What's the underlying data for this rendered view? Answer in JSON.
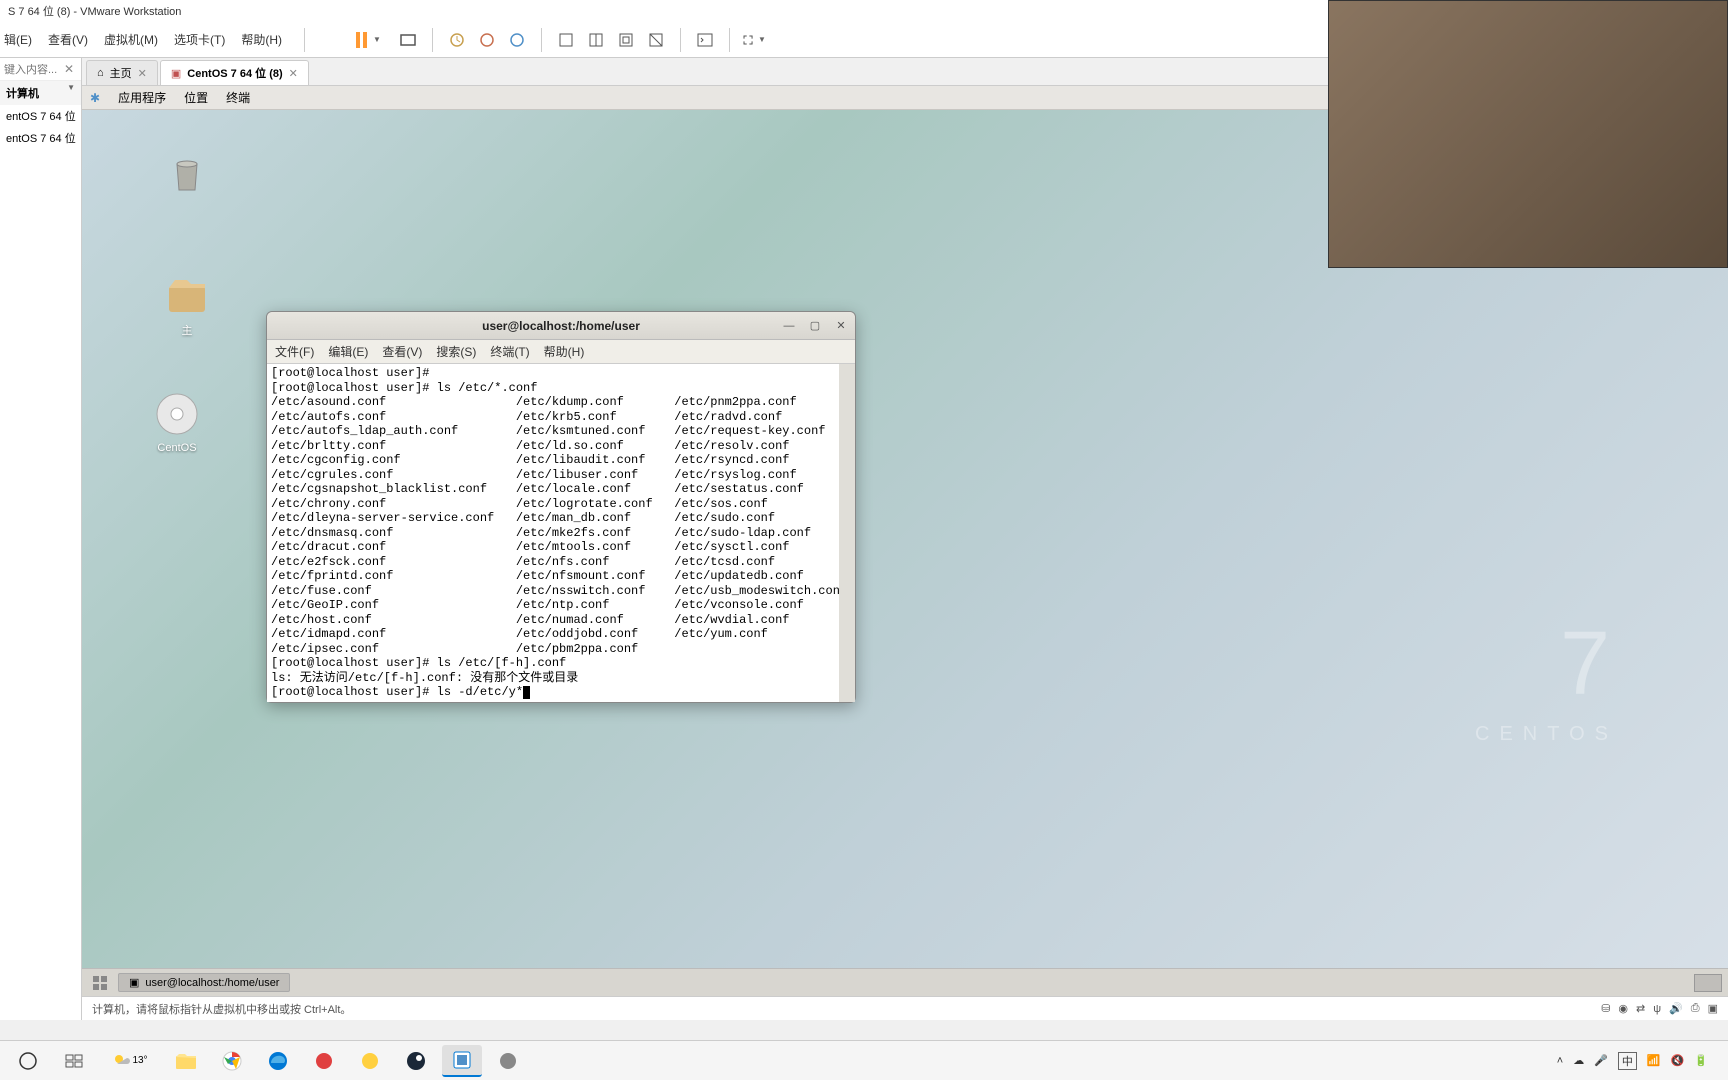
{
  "app": {
    "title": "S 7 64 位 (8) - VMware Workstation"
  },
  "menubar": [
    "辑(E)",
    "查看(V)",
    "虚拟机(M)",
    "选项卡(T)",
    "帮助(H)"
  ],
  "sidebar": {
    "search_placeholder": "键入内容...",
    "lib_header": "计算机",
    "vms": [
      "entOS 7 64 位",
      "entOS 7 64 位"
    ]
  },
  "tabs": [
    {
      "label": "主页",
      "icon": "home",
      "active": false
    },
    {
      "label": "CentOS 7 64 位 (8)",
      "icon": "vm",
      "active": true
    }
  ],
  "guest_menubar": [
    "应用程序",
    "位置",
    "终端"
  ],
  "desktop_icons": [
    {
      "name": "trash",
      "label": ""
    },
    {
      "name": "folder",
      "label": "主"
    },
    {
      "name": "disc",
      "label": "CentOS"
    }
  ],
  "centos_brand": {
    "big": "7",
    "small": "CENTOS"
  },
  "terminal": {
    "title": "user@localhost:/home/user",
    "menus": [
      "文件(F)",
      "编辑(E)",
      "查看(V)",
      "搜索(S)",
      "终端(T)",
      "帮助(H)"
    ],
    "lines": [
      "[root@localhost user]# ",
      "[root@localhost user]# ls /etc/*.conf",
      "/etc/asound.conf                  /etc/kdump.conf       /etc/pnm2ppa.conf",
      "/etc/autofs.conf                  /etc/krb5.conf        /etc/radvd.conf",
      "/etc/autofs_ldap_auth.conf        /etc/ksmtuned.conf    /etc/request-key.conf",
      "/etc/brltty.conf                  /etc/ld.so.conf       /etc/resolv.conf",
      "/etc/cgconfig.conf                /etc/libaudit.conf    /etc/rsyncd.conf",
      "/etc/cgrules.conf                 /etc/libuser.conf     /etc/rsyslog.conf",
      "/etc/cgsnapshot_blacklist.conf    /etc/locale.conf      /etc/sestatus.conf",
      "/etc/chrony.conf                  /etc/logrotate.conf   /etc/sos.conf",
      "/etc/dleyna-server-service.conf   /etc/man_db.conf      /etc/sudo.conf",
      "/etc/dnsmasq.conf                 /etc/mke2fs.conf      /etc/sudo-ldap.conf",
      "/etc/dracut.conf                  /etc/mtools.conf      /etc/sysctl.conf",
      "/etc/e2fsck.conf                  /etc/nfs.conf         /etc/tcsd.conf",
      "/etc/fprintd.conf                 /etc/nfsmount.conf    /etc/updatedb.conf",
      "/etc/fuse.conf                    /etc/nsswitch.conf    /etc/usb_modeswitch.conf",
      "/etc/GeoIP.conf                   /etc/ntp.conf         /etc/vconsole.conf",
      "/etc/host.conf                    /etc/numad.conf       /etc/wvdial.conf",
      "/etc/idmapd.conf                  /etc/oddjobd.conf     /etc/yum.conf",
      "/etc/ipsec.conf                   /etc/pbm2ppa.conf",
      "[root@localhost user]# ls /etc/[f-h].conf",
      "ls: 无法访问/etc/[f-h].conf: 没有那个文件或目录",
      "[root@localhost user]# ls -d/etc/y*"
    ]
  },
  "guest_taskbar": {
    "item": "user@localhost:/home/user"
  },
  "statusbar": {
    "hint": "计算机，请将鼠标指针从虚拟机中移出或按 Ctrl+Alt。"
  },
  "systray": {
    "temp": "13°",
    "ime": "中"
  }
}
